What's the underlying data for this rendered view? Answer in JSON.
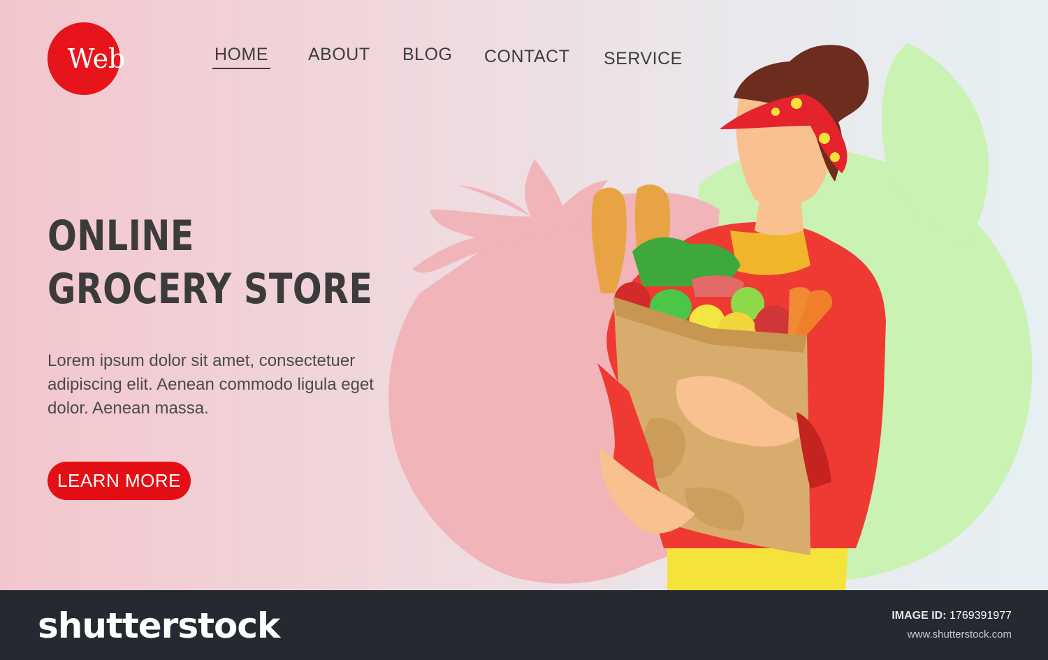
{
  "logo": {
    "text": "Web",
    "color": "#e8141b"
  },
  "nav": {
    "items": [
      {
        "label": "HOME",
        "active": true
      },
      {
        "label": "ABOUT"
      },
      {
        "label": "BLOG"
      },
      {
        "label": "CONTACT"
      },
      {
        "label": "SERVICE"
      }
    ]
  },
  "hero": {
    "title_line1": "ONLINE",
    "title_line2": "GROCERY STORE",
    "description": "Lorem ipsum dolor sit amet, consectetuer adipiscing elit. Aenean commodo ligula eget dolor. Aenean massa.",
    "cta_label": "LEARN MORE"
  },
  "footer": {
    "brand": "shutterstock",
    "image_id_label": "IMAGE ID:",
    "image_id": "1769391977",
    "site": "www.shutterstock.com"
  },
  "colors": {
    "accent": "#e30f14",
    "footer_bg": "#252a32",
    "tomato_pink": "#f0b4b9",
    "leaf_green": "#c9f2b3"
  }
}
